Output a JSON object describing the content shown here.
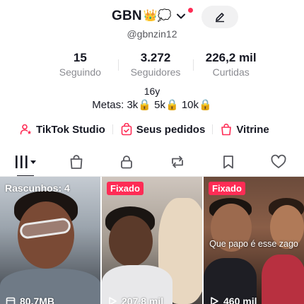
{
  "profile": {
    "display_name": "GBN",
    "name_emojis": "👑💭",
    "handle": "@gbnzin12",
    "stats": [
      {
        "value": "15",
        "label": "Seguindo"
      },
      {
        "value": "3.272",
        "label": "Seguidores"
      },
      {
        "value": "226,2 mil",
        "label": "Curtidas"
      }
    ],
    "bio_line1": "16y",
    "bio_line2": "Metas: 3k🔒 5k🔒 10k🔒"
  },
  "links": [
    {
      "label": "TikTok Studio",
      "icon": "person-star-icon"
    },
    {
      "label": "Seus pedidos",
      "icon": "order-bag-check-icon"
    },
    {
      "label": "Vitrine",
      "icon": "shopping-bag-icon"
    }
  ],
  "tabs": [
    {
      "icon": "videos-grid-icon",
      "active": true
    },
    {
      "icon": "shop-bag-icon"
    },
    {
      "icon": "lock-icon"
    },
    {
      "icon": "repost-icon"
    },
    {
      "icon": "bookmark-icon"
    },
    {
      "icon": "heart-icon"
    }
  ],
  "videos": [
    {
      "badge": "Rascunhos: 4",
      "meta": "80,7MB",
      "meta_icon": "drafts-icon"
    },
    {
      "badge": "Fixado",
      "meta": "207,8 mil",
      "meta_icon": "play-icon"
    },
    {
      "badge": "Fixado",
      "meta": "460 mil",
      "meta_icon": "play-icon",
      "overlay": "Que papo é esse zago"
    }
  ],
  "colors": {
    "accent": "#fe2c55",
    "text": "#161823",
    "muted": "#8a8b91"
  }
}
